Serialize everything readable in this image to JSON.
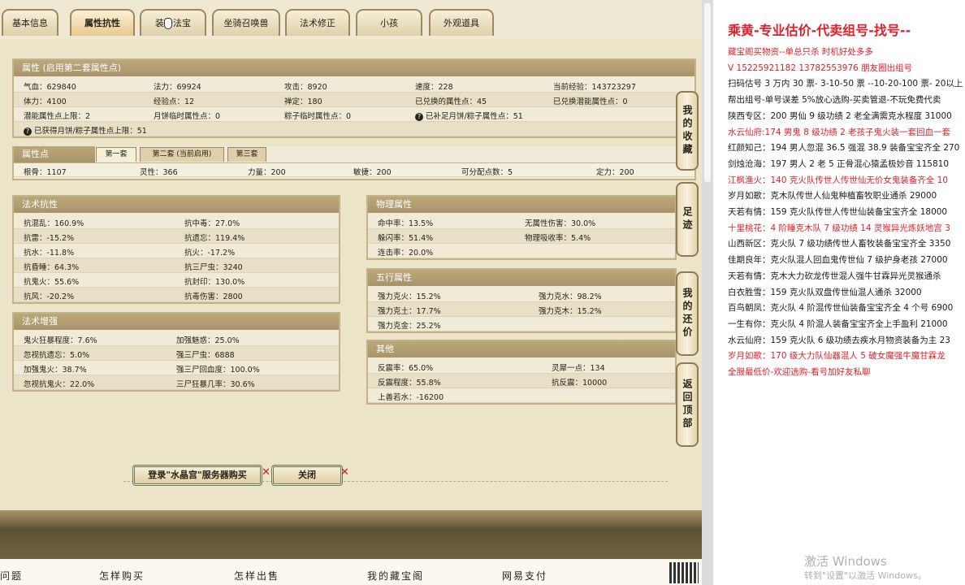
{
  "tabs": [
    {
      "label": "基本信息"
    },
    {
      "label": "属性抗性"
    },
    {
      "label": "装备法宝"
    },
    {
      "label": "坐骑召唤兽"
    },
    {
      "label": "法术修正"
    },
    {
      "label": "小孩"
    },
    {
      "label": "外观道具"
    }
  ],
  "attr": {
    "header": "属性 (启用第二套属性点)",
    "rows": [
      [
        "气血：629840",
        "法力：69924",
        "攻击：8920",
        "速度：228",
        "当前经验：143723297"
      ],
      [
        "体力：4100",
        "经验点：12",
        "禅定：180",
        "已兑换的属性点：45",
        "已兑换潜能属性点：0"
      ],
      [
        "潜能属性点上限：2",
        "月饼临时属性点：0",
        "粽子临时属性点：0",
        "已补足月饼/粽子属性点：51",
        ""
      ],
      [
        "已获得月饼/粽子属性点上限：51",
        "",
        "",
        "",
        ""
      ]
    ]
  },
  "points": {
    "header": "属性点",
    "subtabs": [
      "第一套",
      "第二套 (当前启用)",
      "第三套"
    ],
    "values": [
      "根骨：1107",
      "灵性：366",
      "力量：200",
      "敏捷：200",
      "可分配点数：5",
      "定力：200"
    ]
  },
  "magic_res": {
    "header": "法术抗性",
    "rows": [
      [
        "抗混乱：160.9%",
        "抗中毒：27.0%"
      ],
      [
        "抗雷：-15.2%",
        "抗遗忘：119.4%"
      ],
      [
        "抗水：-11.8%",
        "抗火：-17.2%"
      ],
      [
        "抗昏睡：64.3%",
        "抗三尸虫：3240"
      ],
      [
        "抗鬼火：55.6%",
        "抗封印：130.0%"
      ],
      [
        "抗风：-20.2%",
        "抗毒伤害：2800"
      ]
    ]
  },
  "magic_boost": {
    "header": "法术增强",
    "rows": [
      [
        "鬼火狂暴程度：7.6%",
        "加强魅惑：25.0%"
      ],
      [
        "忽视抗遗忘：5.0%",
        "强三尸虫：6888"
      ],
      [
        "加强鬼火：38.7%",
        "强三尸回血度：100.0%"
      ],
      [
        "忽视抗鬼火：22.0%",
        "三尸狂暴几率：30.6%"
      ]
    ]
  },
  "physical": {
    "header": "物理属性",
    "rows": [
      [
        "命中率：13.5%",
        "无属性伤害：30.0%"
      ],
      [
        "躲闪率：51.4%",
        "物理吸收率：5.4%"
      ],
      [
        "连击率：20.0%",
        ""
      ]
    ]
  },
  "elements": {
    "header": "五行属性",
    "rows": [
      [
        "强力克火：15.2%",
        "强力克水：98.2%"
      ],
      [
        "强力克土：17.7%",
        "强力克木：15.2%"
      ],
      [
        "强力克金：25.2%",
        ""
      ]
    ]
  },
  "other": {
    "header": "其他",
    "rows": [
      [
        "反震率：65.0%",
        "灵犀一点：134"
      ],
      [
        "反震程度：55.8%",
        "抗反震：10000"
      ],
      [
        "上善若水：-16200",
        ""
      ]
    ]
  },
  "side_buttons": [
    {
      "label": "我的收藏"
    },
    {
      "label": "足迹"
    },
    {
      "label": "我的还价"
    },
    {
      "label": "返回顶部"
    }
  ],
  "actions": {
    "login_buy": "登录\"水晶宫\"服务器购买",
    "close": "关闭"
  },
  "footer": [
    "问题",
    "怎样购买",
    "怎样出售",
    "我的藏宝阁",
    "网易支付"
  ],
  "ad": {
    "title": "乘黄-专业估价-代卖组号-找号--",
    "lines": [
      {
        "text": "藏宝阁买物资--单总只杀 时机好处多多",
        "color": "red"
      },
      {
        "text": "V 15225921182    13782553976 朋友圈出组号",
        "color": "red"
      },
      {
        "text": "扫码估号 3 万内 30 票- 3-10-50 票  --10-20-100 票- 20以上",
        "color": "black"
      },
      {
        "text": "帮出组号-单号误差 5%放心选购-买卖管退-不玩免费代卖",
        "color": "black"
      },
      {
        "text": "陕西专区：200 男仙 9 级功绩 2 老全满需克水程度 31000",
        "color": "black"
      },
      {
        "text": "水云仙府:174 男鬼 8 级功绩 2 老孩子鬼火装一套回血一套",
        "color": "red"
      },
      {
        "text": "红颜知己：194 男人忽混 36.5 强混 38.9 装备宝宝齐全 270",
        "color": "black"
      },
      {
        "text": "剑烛沧海：197 男人 2 老 5 正骨混心猿孟极妙音 115810",
        "color": "black"
      },
      {
        "text": "江枫渔火：140 克火队传世人传世仙无价女鬼装备齐全 10",
        "color": "red"
      },
      {
        "text": "岁月如歌：克木队传世人仙鬼种植畜牧职业通杀 29000",
        "color": "black"
      },
      {
        "text": "天若有情：159 克火队传世人传世仙装备宝宝齐全 18000",
        "color": "black"
      },
      {
        "text": "十里桃花：4 阶睡克木队 7 级功绩 14 灵猴异光炼妖地宫 3",
        "color": "red"
      },
      {
        "text": "山西新区：克火队 7 级功绩传世人畜牧装备宝宝齐全 3350",
        "color": "black"
      },
      {
        "text": "佳期良年：克火队混人回血鬼传世仙 7 级护身老孩 27000",
        "color": "black"
      },
      {
        "text": "天若有情：克木大力砍龙传世混人强牛甘霖异光灵猴通杀",
        "color": "black"
      },
      {
        "text": "白衣胜雪：159 克火队双盘传世仙混人通杀 32000",
        "color": "black"
      },
      {
        "text": "百鸟朝凤：克火队 4 阶混传世仙装备宝宝齐全 4 个号 6900",
        "color": "black"
      },
      {
        "text": "一生有你：克火队 4 阶混人装备宝宝齐全上手盈利 21000",
        "color": "black"
      },
      {
        "text": "水云仙府：159 克火队 6 级功绩去疾水月物资装备为主 23",
        "color": "black"
      },
      {
        "text": "岁月如歌：170 级大力队仙器混人 5 破女魔强牛魔甘霖龙",
        "color": "red"
      },
      {
        "text": "全服最低价-欢迎选购-看号加好友私聊",
        "color": "red"
      }
    ],
    "watermark1": "激活 Windows",
    "watermark2": "转到\"设置\"以激活 Windows。"
  }
}
